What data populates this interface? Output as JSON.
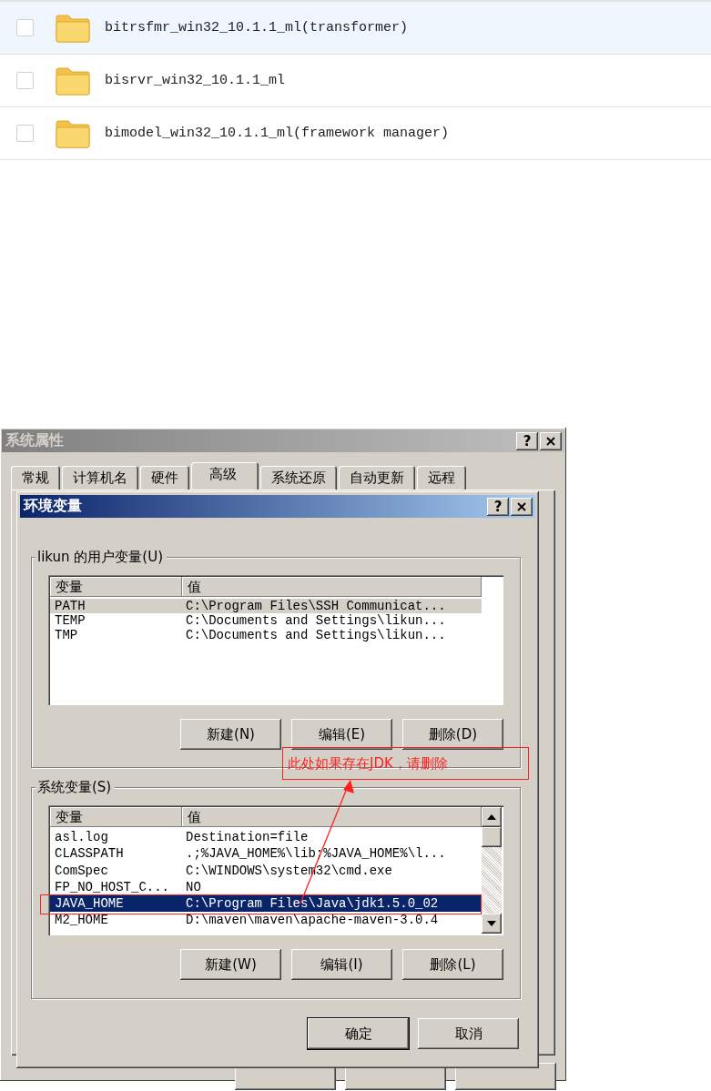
{
  "files": [
    {
      "name": "bitrsfmr_win32_10.1.1_ml(transformer)",
      "selected": true,
      "checked": false
    },
    {
      "name": "bisrvr_win32_10.1.1_ml",
      "selected": false,
      "checked": false
    },
    {
      "name": "bimodel_win32_10.1.1_ml(framework manager)",
      "selected": false,
      "checked": false
    }
  ],
  "system_properties": {
    "title": "系统属性",
    "help": "?",
    "active": false,
    "tabs": [
      {
        "label": "常规",
        "selected": false
      },
      {
        "label": "计算机名",
        "selected": false
      },
      {
        "label": "硬件",
        "selected": false
      },
      {
        "label": "高级",
        "selected": true
      },
      {
        "label": "系统还原",
        "selected": false
      },
      {
        "label": "自动更新",
        "selected": false
      },
      {
        "label": "远程",
        "selected": false
      }
    ]
  },
  "environment_variables": {
    "title": "环境变量",
    "help": "?",
    "active": true,
    "groups": [
      {
        "label": "likun 的用户变量(U)",
        "columns": [
          "变量",
          "值"
        ],
        "focused": false,
        "scrollbar": false,
        "rows": [
          {
            "name": "PATH",
            "value": "C:\\Program Files\\SSH Communicat...",
            "selected": true
          },
          {
            "name": "TEMP",
            "value": "C:\\Documents and Settings\\likun...",
            "selected": false
          },
          {
            "name": "TMP",
            "value": "C:\\Documents and Settings\\likun...",
            "selected": false
          }
        ],
        "buttons": [
          "新建(N)",
          "编辑(E)",
          "删除(D)"
        ]
      },
      {
        "label": "系统变量(S)",
        "columns": [
          "变量",
          "值"
        ],
        "focused": true,
        "scrollbar": true,
        "rows": [
          {
            "name": "asl.log",
            "value": "Destination=file",
            "selected": false
          },
          {
            "name": "CLASSPATH",
            "value": ".;%JAVA_HOME%\\lib;%JAVA_HOME%\\l...",
            "selected": false
          },
          {
            "name": "ComSpec",
            "value": "C:\\WINDOWS\\system32\\cmd.exe",
            "selected": false
          },
          {
            "name": "FP_NO_HOST_C...",
            "value": "NO",
            "selected": false
          },
          {
            "name": "JAVA_HOME",
            "value": "C:\\Program Files\\Java\\jdk1.5.0_02",
            "selected": true
          },
          {
            "name": "M2_HOME",
            "value": "D:\\maven\\maven\\apache-maven-3.0.4",
            "selected": false
          }
        ],
        "buttons": [
          "新建(W)",
          "编辑(I)",
          "删除(L)"
        ]
      }
    ],
    "buttons": [
      "确定",
      "取消"
    ]
  },
  "annotation": {
    "text": "此处如果存在JDK，请删除"
  }
}
